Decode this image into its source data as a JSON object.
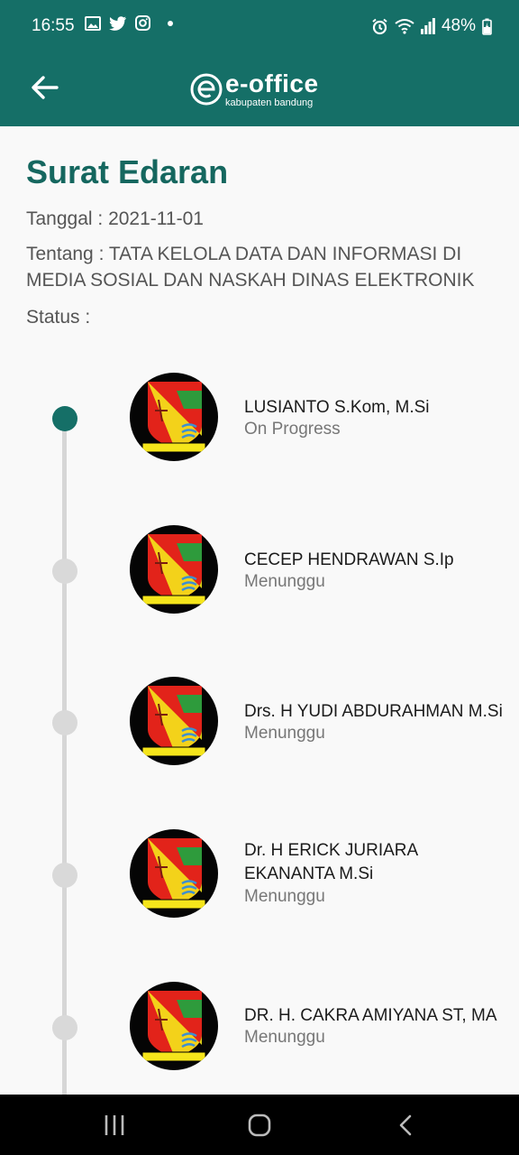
{
  "status_bar": {
    "time": "16:55",
    "battery": "48%"
  },
  "app_bar": {
    "brand_title": "e-office",
    "brand_subtitle": "kabupaten bandung"
  },
  "page": {
    "title": "Surat Edaran",
    "date_text": "Tanggal : 2021-11-01",
    "subject_text": "Tentang : TATA KELOLA DATA DAN INFORMASI DI MEDIA SOSIAL DAN NASKAH DINAS ELEKTRONIK",
    "status_label": "Status :"
  },
  "approvers": [
    {
      "name": "LUSIANTO S.Kom, M.Si",
      "state": "On Progress"
    },
    {
      "name": "CECEP HENDRAWAN S.Ip",
      "state": "Menunggu"
    },
    {
      "name": "Drs. H YUDI ABDURAHMAN M.Si",
      "state": "Menunggu"
    },
    {
      "name": "Dr. H ERICK JURIARA EKANANTA M.Si",
      "state": "Menunggu"
    },
    {
      "name": "DR. H. CAKRA AMIYANA ST, MA",
      "state": "Menunggu"
    }
  ],
  "logo_motto": "REPEH RAPIH KERTA RAHARJA",
  "colors": {
    "primary": "#156f67",
    "inactive_dot": "#d9d9d9",
    "title": "#15675f"
  },
  "icons": {
    "back": "arrow-left-icon",
    "status_left": [
      "gallery-icon",
      "twitter-icon",
      "instagram-icon",
      "notification-dot-icon"
    ],
    "status_right": [
      "alarm-icon",
      "wifi-icon",
      "signal-icon",
      "battery-charging-icon"
    ],
    "nav": [
      "recent-apps-icon",
      "home-icon",
      "back-nav-icon"
    ]
  }
}
